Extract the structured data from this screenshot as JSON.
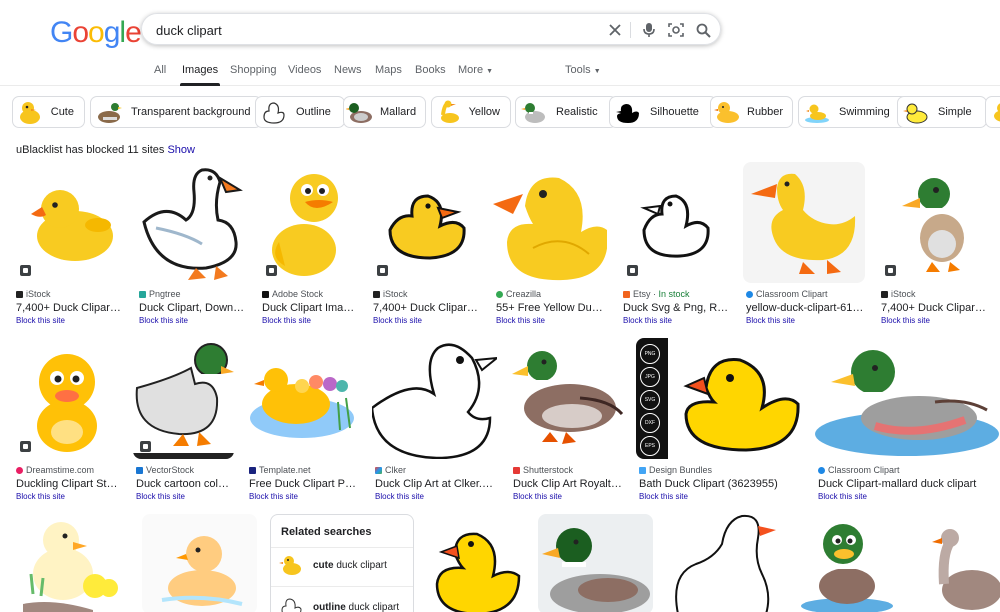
{
  "logo": "Google",
  "search": {
    "value": "duck clipart"
  },
  "icons": {
    "clear": "close-icon",
    "voice": "mic-icon",
    "lens": "camera-icon",
    "search": "search-icon"
  },
  "nav": {
    "all": "All",
    "images": "Images",
    "shopping": "Shopping",
    "videos": "Videos",
    "news": "News",
    "maps": "Maps",
    "books": "Books",
    "more": "More",
    "tools": "Tools"
  },
  "chips": [
    "Cute",
    "Transparent background",
    "Outline",
    "Mallard",
    "Yellow",
    "Realistic",
    "Silhouette",
    "Rubber",
    "Swimming",
    "Simple"
  ],
  "blocked": {
    "text": "uBlacklist has blocked 11 sites",
    "link": "Show"
  },
  "block_label": "Block this site",
  "results_row1": [
    {
      "source": "iStock",
      "title": "7,400+ Duck Clipart ..."
    },
    {
      "source": "Pngtree",
      "title": "Duck Clipart, Downlo..."
    },
    {
      "source": "Adobe Stock",
      "title": "Duck Clipart Image..."
    },
    {
      "source": "iStock",
      "title": "7,400+ Duck Clipart ..."
    },
    {
      "source": "Creazilla",
      "title": "55+ Free Yellow Duck ..."
    },
    {
      "source": "Etsy",
      "stock": "In stock",
      "title": "Duck Svg & Png, Rub..."
    },
    {
      "source": "Classroom Clipart",
      "title": "yellow-duck-clipart-6125..."
    },
    {
      "source": "iStock",
      "title": "7,400+ Duck Clipart ..."
    }
  ],
  "results_row2": [
    {
      "source": "Dreamstime.com",
      "title": "Duckling Clipart Stoc..."
    },
    {
      "source": "VectorStock",
      "title": "Duck cartoon color..."
    },
    {
      "source": "Template.net",
      "title": "Free Duck Clipart PN..."
    },
    {
      "source": "Clker",
      "title": "Duck Clip Art at Clker.co..."
    },
    {
      "source": "Shutterstock",
      "title": "Duck Clip Art Royalty-..."
    },
    {
      "source": "Design Bundles",
      "title": "Bath Duck Clipart (3623955)"
    },
    {
      "source": "Classroom Clipart",
      "title": "Duck Clipart-mallard duck clipart"
    }
  ],
  "format_badges": [
    "PNG",
    "JPG",
    "SVG",
    "DXF",
    "EPS"
  ],
  "related": {
    "header": "Related searches",
    "items": [
      {
        "bold": "cute",
        "rest": " duck clipart"
      },
      {
        "bold": "outline",
        "rest": " duck clipart"
      }
    ]
  },
  "colors": {
    "link": "#1a0dab",
    "duck_yellow": "#f7c51e",
    "beak_orange": "#f28b1a"
  }
}
